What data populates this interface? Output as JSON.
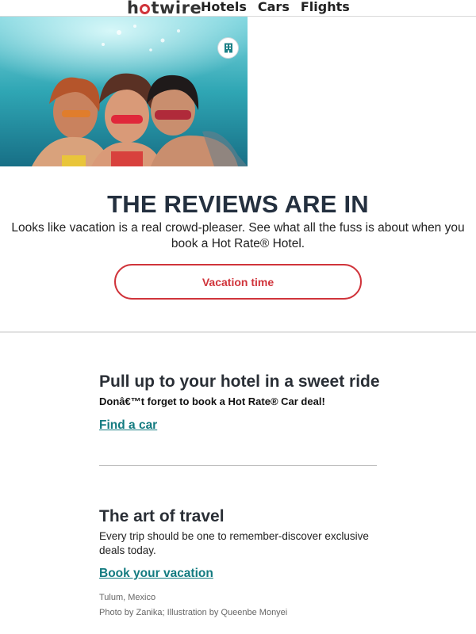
{
  "header": {
    "logo_text": "hotwire",
    "nav": [
      "Hotels",
      "Cars",
      "Flights"
    ]
  },
  "hero": {
    "icon": "hotel-building-icon"
  },
  "reviews": {
    "headline": "THE REVIEWS ARE IN",
    "subcopy": "Looks like vacation is a real crowd-pleaser. See what all the fuss is about when you book a Hot Rate® Hotel.",
    "button_label": "Vacation time"
  },
  "car": {
    "title": "Pull up to your hotel in a sweet ride",
    "subtitle": "Donâ€™t forget to book a Hot Rate® Car deal!",
    "link_label": "Find a car"
  },
  "art": {
    "title": "The art of travel",
    "body": "Every trip should be one to remember-discover exclusive deals today.",
    "link_label": "Book your vacation",
    "caption_location": "Tulum, Mexico",
    "caption_credit": "Photo by Zanika; Illustration by Queenbe Monyei"
  },
  "colors": {
    "brand_red": "#d0343b",
    "link_teal": "#137b80",
    "headline_navy": "#24303f"
  }
}
